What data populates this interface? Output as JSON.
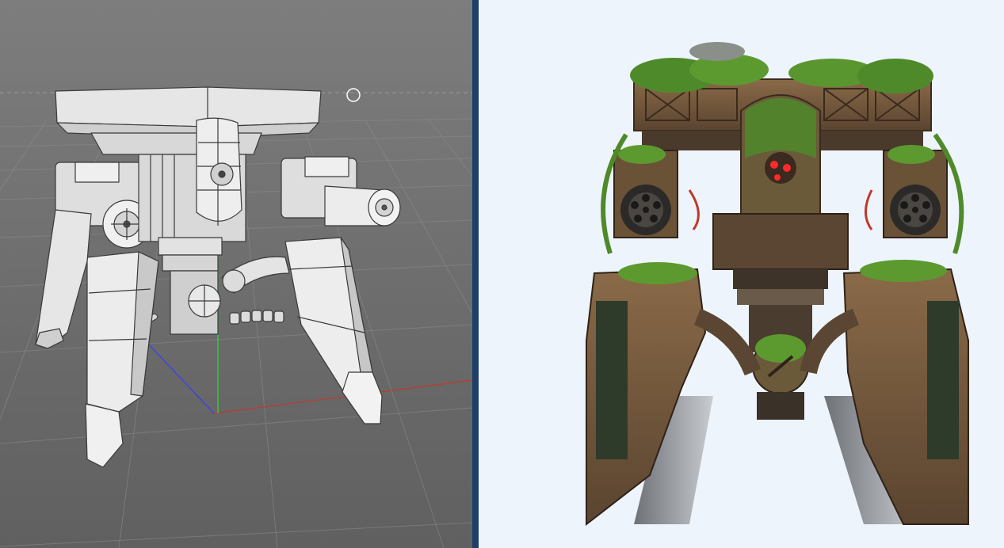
{
  "viewport": {
    "background": "#737373",
    "grid_color": "#8a8a8a",
    "axis_colors": {
      "x": "#c0392b",
      "y": "#2ecc40",
      "z": "#3a3aff"
    },
    "cursor_icon": "circle-cursor-icon",
    "model": "quad-leg-turret-mech-wireframe"
  },
  "divider": {
    "color": "#1e3f6b"
  },
  "reference": {
    "background": "#eef4fb",
    "image": "moss-covered-mech-concept-art",
    "accent_colors": {
      "rust": "#7a5a3a",
      "moss": "#4f8a2a",
      "eyes": "#ff2a2a"
    }
  }
}
